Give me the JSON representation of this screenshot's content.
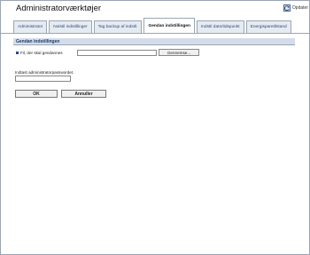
{
  "window": {
    "title": "Administratorværktøjer",
    "update_label": "Opdater"
  },
  "tabs": [
    {
      "label": "Administrator"
    },
    {
      "label": "Nulstil indstillinger"
    },
    {
      "label": "Tag backup af indstil."
    },
    {
      "label": "Gendan indstillingen"
    },
    {
      "label": "Indstil dato/tidspunkt"
    },
    {
      "label": "Energisparetilstand"
    }
  ],
  "active_tab": "Gendan indstillingen",
  "section": {
    "heading": "Gendan indstillingen",
    "file_label": "Fil, der skal gendannes",
    "file_value": "",
    "browse_label": "Gennemse..."
  },
  "password": {
    "label": "Indtast administratorpasswordet.",
    "value": ""
  },
  "buttons": {
    "ok": "OK",
    "cancel": "Annuller"
  },
  "colors": {
    "accent": "#2c4a78",
    "section_bg": "#d4dcea",
    "tab_bg": "#e6ebf2"
  }
}
